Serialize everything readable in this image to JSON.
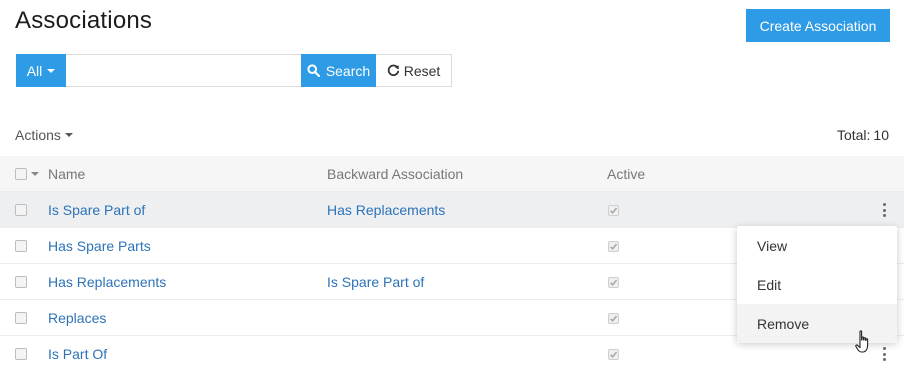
{
  "page": {
    "title": "Associations"
  },
  "toolbar": {
    "create_label": "Create Association"
  },
  "search": {
    "filter_label": "All",
    "value": "",
    "placeholder": "",
    "search_label": "Search",
    "reset_label": "Reset"
  },
  "list": {
    "actions_label": "Actions",
    "total_label": "Total:",
    "total_count": "10"
  },
  "table": {
    "columns": {
      "name": "Name",
      "backward": "Backward Association",
      "active": "Active"
    },
    "rows": [
      {
        "name": "Is Spare Part of",
        "backward": "Has Replacements",
        "active": true
      },
      {
        "name": "Has Spare Parts",
        "backward": "",
        "active": true
      },
      {
        "name": "Has Replacements",
        "backward": "Is Spare Part of",
        "active": true
      },
      {
        "name": "Replaces",
        "backward": "",
        "active": true
      },
      {
        "name": "Is Part Of",
        "backward": "",
        "active": true
      }
    ]
  },
  "row_menu": {
    "view": "View",
    "edit": "Edit",
    "remove": "Remove"
  },
  "colors": {
    "accent": "#2d9be5",
    "link": "#2d73b8",
    "row_hover": "#edeff1"
  },
  "icons": {
    "search": "search-icon",
    "reset": "refresh-icon",
    "row_actions": "kebab-icon",
    "cursor": "hand-pointer-icon"
  }
}
